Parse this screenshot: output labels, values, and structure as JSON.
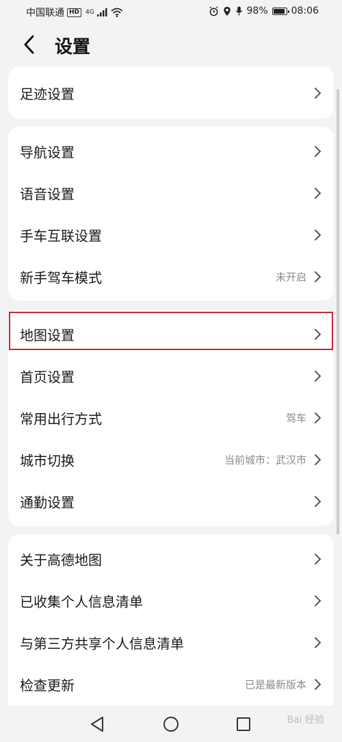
{
  "status_bar": {
    "carrier": "中国联通",
    "hd": "HD",
    "network": "4G",
    "battery": "98%",
    "time": "08:06"
  },
  "header": {
    "title": "设置"
  },
  "groups": [
    {
      "items": [
        {
          "label": "足迹设置",
          "value": ""
        }
      ]
    },
    {
      "items": [
        {
          "label": "导航设置",
          "value": ""
        },
        {
          "label": "语音设置",
          "value": ""
        },
        {
          "label": "手车互联设置",
          "value": ""
        },
        {
          "label": "新手驾车模式",
          "value": "未开启"
        }
      ]
    },
    {
      "items": [
        {
          "label": "地图设置",
          "value": ""
        },
        {
          "label": "首页设置",
          "value": ""
        },
        {
          "label": "常用出行方式",
          "value": "驾车"
        },
        {
          "label": "城市切换",
          "value": "当前城市：武汉市"
        },
        {
          "label": "通勤设置",
          "value": ""
        }
      ]
    },
    {
      "items": [
        {
          "label": "关于高德地图",
          "value": ""
        },
        {
          "label": "已收集个人信息清单",
          "value": ""
        },
        {
          "label": "与第三方共享个人信息清单",
          "value": ""
        },
        {
          "label": "检查更新",
          "value": "已是最新版本"
        }
      ]
    }
  ],
  "watermark": "Bai 经验",
  "accent_color": "#c8262f"
}
